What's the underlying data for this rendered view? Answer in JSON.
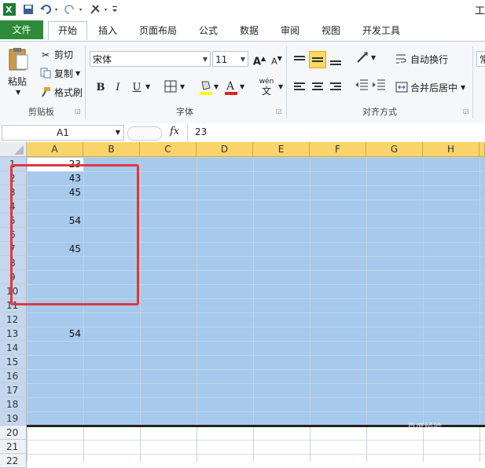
{
  "titlebar": {
    "title_partial": "工"
  },
  "tabs": [
    "文件",
    "开始",
    "插入",
    "页面布局",
    "公式",
    "数据",
    "审阅",
    "视图",
    "开发工具"
  ],
  "clipboard": {
    "paste": "粘贴",
    "cut": "剪切",
    "copy": "复制",
    "format_painter": "格式刷",
    "group": "剪贴板"
  },
  "font": {
    "name": "宋体",
    "size": "11",
    "bold": "B",
    "italic": "I",
    "underline": "U",
    "group": "字体",
    "grow": "A",
    "shrink": "A",
    "phonetic": "wén"
  },
  "alignment": {
    "wrap_text": "自动换行",
    "merge_center": "合并后居中",
    "group": "对齐方式",
    "number_format_partial": "常"
  },
  "formula_bar": {
    "name_box": "A1",
    "fx": "fx",
    "value": "23"
  },
  "columns": [
    "A",
    "B",
    "C",
    "D",
    "E",
    "F",
    "G",
    "H"
  ],
  "rows": [
    "1",
    "2",
    "3",
    "4",
    "5",
    "6",
    "7",
    "8",
    "9",
    "10",
    "11",
    "12",
    "13",
    "14",
    "15",
    "16",
    "17",
    "18",
    "19",
    "20",
    "21",
    "22"
  ],
  "cells_a": [
    "23",
    "43",
    "45",
    "",
    "54",
    "",
    "45",
    "",
    "",
    "",
    "",
    "",
    "54",
    "",
    "",
    "",
    "",
    "",
    "",
    "",
    "",
    ""
  ],
  "watermark": "百度经验",
  "colors": {
    "selection": "#a6c9ec",
    "header_selected": "#f9d46a",
    "file_tab": "#2e8b3a",
    "highlight_box": "#e0383e"
  }
}
